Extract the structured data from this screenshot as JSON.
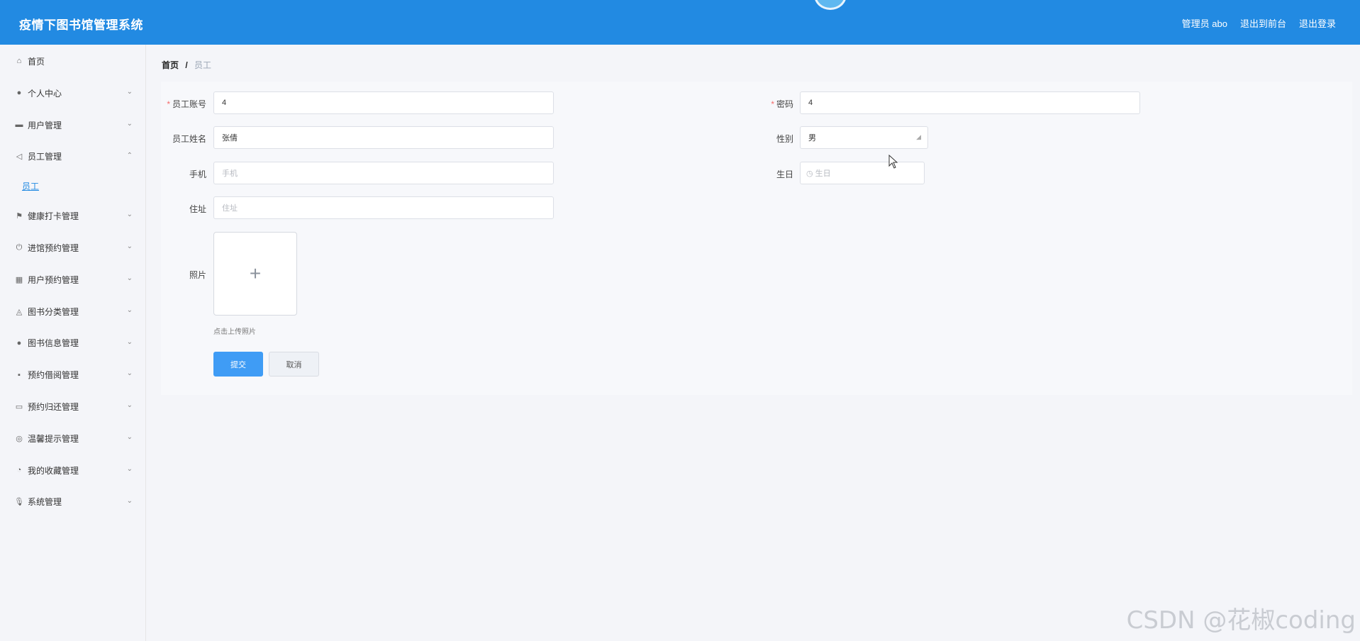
{
  "header": {
    "app_title": "疫情下图书馆管理系统",
    "admin_label": "管理员 abo",
    "exit_front": "退出到前台",
    "logout": "退出登录",
    "bg_color": "#228ae2"
  },
  "sidebar": {
    "items": [
      {
        "label": "首页",
        "icon": "home-icon",
        "has_submenu": false
      },
      {
        "label": "个人中心",
        "icon": "user-icon",
        "has_submenu": true
      },
      {
        "label": "用户管理",
        "icon": "ticket-icon",
        "has_submenu": true
      },
      {
        "label": "员工管理",
        "icon": "send-icon",
        "has_submenu": true,
        "expanded": true
      },
      {
        "label": "健康打卡管理",
        "icon": "flag-icon",
        "has_submenu": true
      },
      {
        "label": "进馆预约管理",
        "icon": "power-icon",
        "has_submenu": true
      },
      {
        "label": "用户预约管理",
        "icon": "grid-icon",
        "has_submenu": true
      },
      {
        "label": "图书分类管理",
        "icon": "bell-off-icon",
        "has_submenu": true
      },
      {
        "label": "图书信息管理",
        "icon": "person-icon",
        "has_submenu": true
      },
      {
        "label": "预约借阅管理",
        "icon": "apps-icon",
        "has_submenu": true
      },
      {
        "label": "预约归还管理",
        "icon": "message-icon",
        "has_submenu": true
      },
      {
        "label": "温馨提示管理",
        "icon": "aim-icon",
        "has_submenu": true
      },
      {
        "label": "我的收藏管理",
        "icon": "compass-icon",
        "has_submenu": true
      },
      {
        "label": "系统管理",
        "icon": "mic-icon",
        "has_submenu": true
      }
    ],
    "submenu_employee": "员工"
  },
  "breadcrumb": {
    "home": "首页",
    "separator": "/",
    "current": "员工"
  },
  "form": {
    "account_label": "员工账号",
    "account_value": "4",
    "password_label": "密码",
    "password_value": "4",
    "name_label": "员工姓名",
    "name_value": "张倩",
    "gender_label": "性别",
    "gender_value": "男",
    "phone_label": "手机",
    "phone_placeholder": "手机",
    "birthday_label": "生日",
    "birthday_placeholder": "生日",
    "address_label": "住址",
    "address_placeholder": "住址",
    "photo_label": "照片",
    "upload_hint": "点击上传照片",
    "submit_label": "提交",
    "cancel_label": "取消"
  },
  "watermark": "CSDN @花椒coding"
}
